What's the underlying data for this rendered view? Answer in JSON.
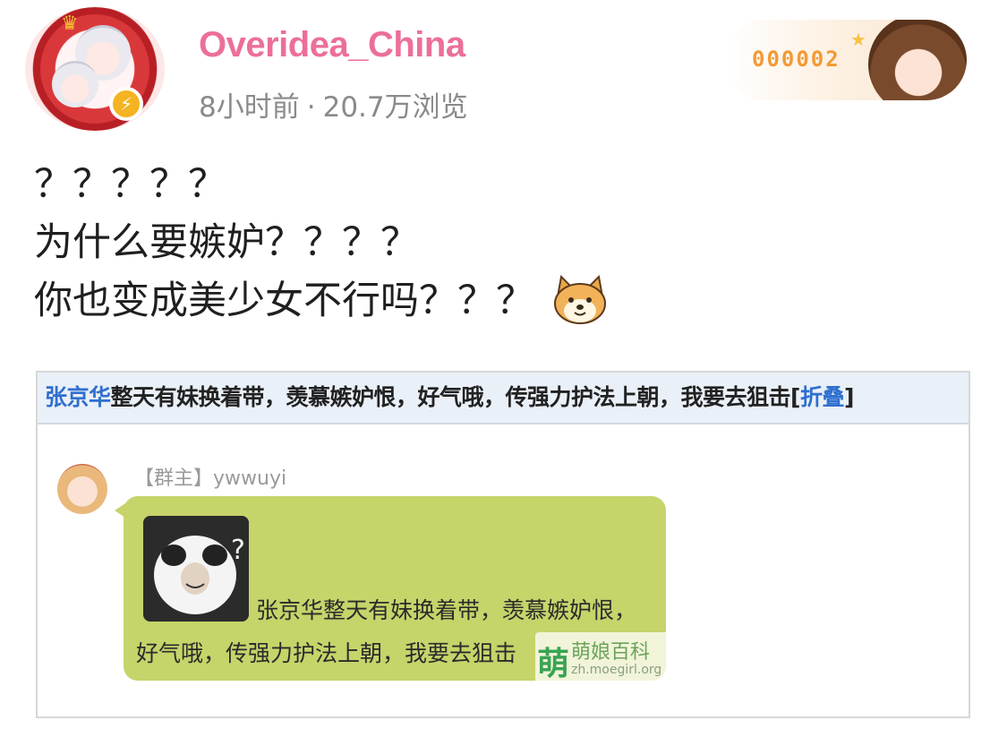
{
  "header": {
    "username": "Overidea_China",
    "time": "8小时前",
    "separator": "·",
    "views": "20.7万浏览",
    "verified_icon": "lightning-verified-icon",
    "fan_badge_number": "000002"
  },
  "post": {
    "lines": [
      "？？？？？",
      "为什么要嫉妒？？？？",
      "你也变成美少女不行吗？？？"
    ],
    "emoji": "doge-emoji-icon"
  },
  "embedded_image": {
    "headline_name": "张京华",
    "headline_text": "整天有妹换着带，羡慕嫉妒恨，好气哦，传强力护法上朝，我要去狙击",
    "fold_open": "[",
    "fold_link": "折叠",
    "fold_close": "]",
    "chat_role": "【群主】",
    "chat_user": "ywwuyi",
    "bubble_line_1": "张京华整天有妹换着带，羡慕嫉妒恨，",
    "bubble_line_2": "好气哦，传强力护法上朝，我要去狙击",
    "watermark_char": "萌",
    "watermark_name": "萌娘百科",
    "watermark_url": "zh.moegirl.org"
  },
  "colors": {
    "username": "#ec6f9a",
    "meta": "#8a8a8a",
    "link": "#2f6fcf",
    "bubble": "#c6d46a",
    "fan_number": "#f29a36"
  }
}
